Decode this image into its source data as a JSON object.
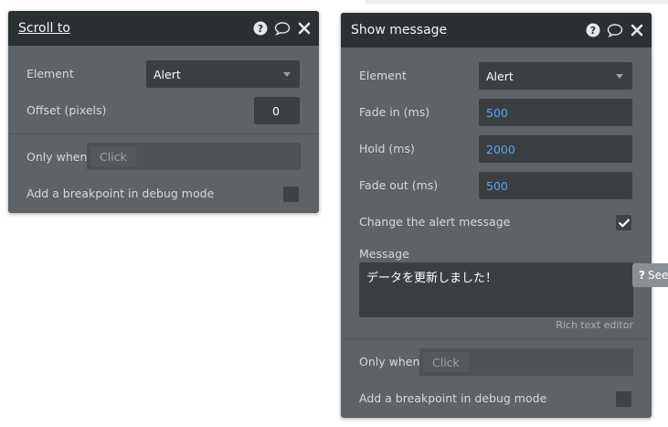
{
  "scroll_panel": {
    "title": "Scroll to",
    "element_label": "Element",
    "element_value": "Alert",
    "offset_label": "Offset (pixels)",
    "offset_value": "0",
    "only_when_label": "Only when",
    "only_when_placeholder": "Click",
    "breakpoint_label": "Add a breakpoint in debug mode"
  },
  "message_panel": {
    "title": "Show message",
    "element_label": "Element",
    "element_value": "Alert",
    "fade_in_label": "Fade in (ms)",
    "fade_in_value": "500",
    "hold_label": "Hold (ms)",
    "hold_value": "2000",
    "fade_out_label": "Fade out (ms)",
    "fade_out_value": "500",
    "change_label": "Change the alert message",
    "change_checked": true,
    "message_label": "Message",
    "message_value": "データを更新しました！",
    "rich_text_label": "Rich text editor",
    "only_when_label": "Only when",
    "only_when_placeholder": "Click",
    "breakpoint_label": "Add a breakpoint in debug mode"
  },
  "side_tab": {
    "label": "See"
  },
  "icons": [
    "help-icon",
    "comment-icon",
    "close-icon",
    "dropdown-caret-icon",
    "checkmark-icon"
  ],
  "colors": {
    "panel_bg": "#5d6367",
    "header_bg": "#2b3033",
    "field_bg": "#3a3f42",
    "value_blue": "#5aa5e8"
  }
}
